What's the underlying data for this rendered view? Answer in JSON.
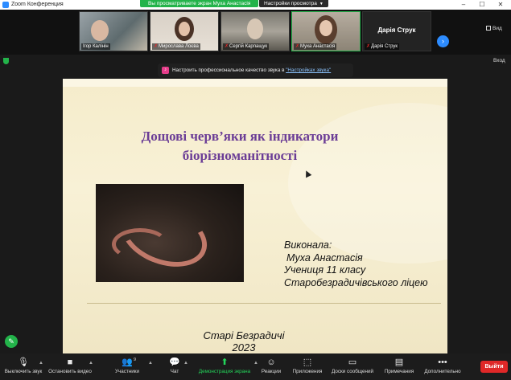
{
  "window": {
    "title": "Zoom Конференция",
    "share_banner": "Вы просматриваете экран Муха Анастасія",
    "view_options": "Настройки просмотра"
  },
  "gallery": {
    "participants": [
      {
        "name": "Ігор Калінін",
        "muted": false
      },
      {
        "name": "Мирослава Лоєва",
        "muted": true
      },
      {
        "name": "Сергій Карпащук",
        "muted": true
      },
      {
        "name": "Муха Анастасія",
        "muted": true
      },
      {
        "name": "Дарія Струк",
        "muted": true
      }
    ],
    "name_only_tile": "Дарія Струк",
    "view_label": "Вид",
    "exit_fullscreen_label": "Вход"
  },
  "notice": {
    "text": "Настроить профессиональное качество звука в ",
    "link": "\"Настройках звука\""
  },
  "slide": {
    "title": "Дощові черв’яки як індикатори біорізноманітності",
    "author_lines": [
      "Виконала:",
      "Муха Анастасія",
      "Учениця 11 класу",
      "Старобезрадичівського ліцею"
    ],
    "footer_lines": [
      "Старі Безрадичі",
      "2023"
    ]
  },
  "toolbar": {
    "items": [
      {
        "label": "Выключить звук",
        "icon": "microphone-icon"
      },
      {
        "label": "Остановить видео",
        "icon": "video-camera-icon"
      },
      {
        "label": "Участники",
        "icon": "participants-icon",
        "count": "9"
      },
      {
        "label": "Чат",
        "icon": "chat-icon"
      },
      {
        "label": "Демонстрация экрана",
        "icon": "share-screen-icon"
      },
      {
        "label": "Реакции",
        "icon": "reactions-icon"
      },
      {
        "label": "Приложения",
        "icon": "apps-icon"
      },
      {
        "label": "Доски сообщений",
        "icon": "whiteboard-icon"
      },
      {
        "label": "Примечания",
        "icon": "notes-icon"
      },
      {
        "label": "Дополнительно",
        "icon": "more-icon"
      }
    ],
    "exit_label": "Выйти"
  },
  "colors": {
    "share_green": "#23b34a",
    "accent_blue": "#2d8cff",
    "exit_red": "#e02828",
    "slide_title_purple": "#6b3d96"
  }
}
